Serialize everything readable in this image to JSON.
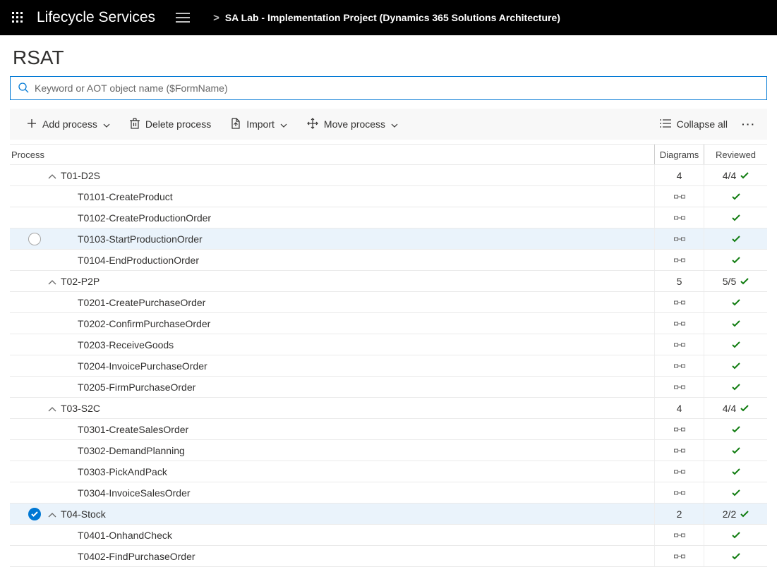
{
  "topbar": {
    "brand": "Lifecycle Services",
    "breadcrumb_sep": ">",
    "breadcrumb": "SA Lab - Implementation Project (Dynamics 365 Solutions Architecture)"
  },
  "page": {
    "title": "RSAT",
    "search_placeholder": "Keyword or AOT object name ($FormName)"
  },
  "toolbar": {
    "add": "Add process",
    "delete": "Delete process",
    "import": "Import",
    "move": "Move process",
    "collapse": "Collapse all"
  },
  "columns": {
    "process": "Process",
    "diagrams": "Diagrams",
    "reviewed": "Reviewed"
  },
  "rows": [
    {
      "id": "t01",
      "type": "group",
      "label": "T01-D2S",
      "diagrams": "4",
      "reviewed": "4/4",
      "highlight": false,
      "selected": false
    },
    {
      "id": "t0101",
      "type": "child",
      "label": "T0101-CreateProduct",
      "highlight": false
    },
    {
      "id": "t0102",
      "type": "child",
      "label": "T0102-CreateProductionOrder",
      "highlight": false
    },
    {
      "id": "t0103",
      "type": "child",
      "label": "T0103-StartProductionOrder",
      "highlight": true,
      "showradio": true
    },
    {
      "id": "t0104",
      "type": "child",
      "label": "T0104-EndProductionOrder",
      "highlight": false
    },
    {
      "id": "t02",
      "type": "group",
      "label": "T02-P2P",
      "diagrams": "5",
      "reviewed": "5/5",
      "highlight": false,
      "selected": false
    },
    {
      "id": "t0201",
      "type": "child",
      "label": "T0201-CreatePurchaseOrder",
      "highlight": false
    },
    {
      "id": "t0202",
      "type": "child",
      "label": "T0202-ConfirmPurchaseOrder",
      "highlight": false
    },
    {
      "id": "t0203",
      "type": "child",
      "label": "T0203-ReceiveGoods",
      "highlight": false
    },
    {
      "id": "t0204",
      "type": "child",
      "label": "T0204-InvoicePurchaseOrder",
      "highlight": false
    },
    {
      "id": "t0205",
      "type": "child",
      "label": "T0205-FirmPurchaseOrder",
      "highlight": false
    },
    {
      "id": "t03",
      "type": "group",
      "label": "T03-S2C",
      "diagrams": "4",
      "reviewed": "4/4",
      "highlight": false,
      "selected": false
    },
    {
      "id": "t0301",
      "type": "child",
      "label": "T0301-CreateSalesOrder",
      "highlight": false
    },
    {
      "id": "t0302",
      "type": "child",
      "label": "T0302-DemandPlanning",
      "highlight": false
    },
    {
      "id": "t0303",
      "type": "child",
      "label": "T0303-PickAndPack",
      "highlight": false
    },
    {
      "id": "t0304",
      "type": "child",
      "label": "T0304-InvoiceSalesOrder",
      "highlight": false
    },
    {
      "id": "t04",
      "type": "group",
      "label": "T04-Stock",
      "diagrams": "2",
      "reviewed": "2/2",
      "highlight": true,
      "selected": true
    },
    {
      "id": "t0401",
      "type": "child",
      "label": "T0401-OnhandCheck",
      "highlight": false
    },
    {
      "id": "t0402",
      "type": "child",
      "label": "T0402-FindPurchaseOrder",
      "highlight": false
    }
  ]
}
